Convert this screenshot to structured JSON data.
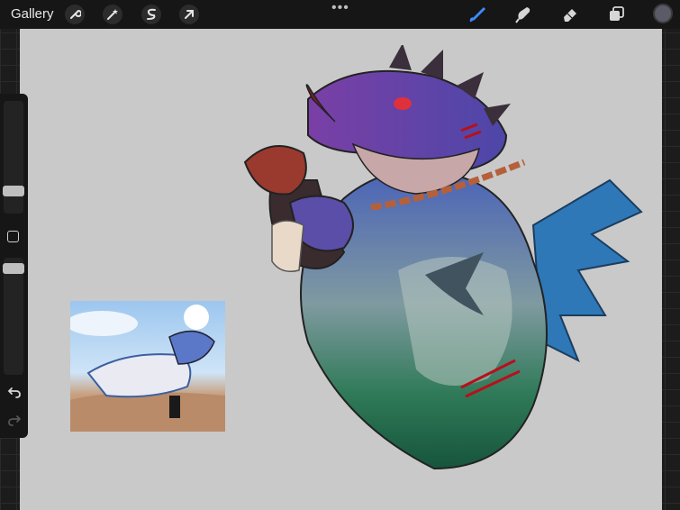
{
  "topbar": {
    "gallery_label": "Gallery",
    "more_dots": "•••",
    "left_tools": [
      {
        "name": "wrench-icon"
      },
      {
        "name": "magic-wand-icon"
      },
      {
        "name": "selection-s-icon"
      },
      {
        "name": "transform-arrow-icon"
      }
    ],
    "right_tools": [
      {
        "name": "brush-icon",
        "color": "#3d8bff",
        "active": true
      },
      {
        "name": "smudge-icon"
      },
      {
        "name": "eraser-icon"
      },
      {
        "name": "layers-icon"
      }
    ],
    "current_color": "#5a5b66"
  },
  "sidebar": {
    "tools": [
      "brush-size-slider",
      "modify-button",
      "opacity-slider",
      "undo-icon",
      "redo-icon"
    ]
  },
  "colors": {
    "canvas": "#c9c9c9",
    "chrome": "#161616",
    "accent": "#3d8bff"
  }
}
